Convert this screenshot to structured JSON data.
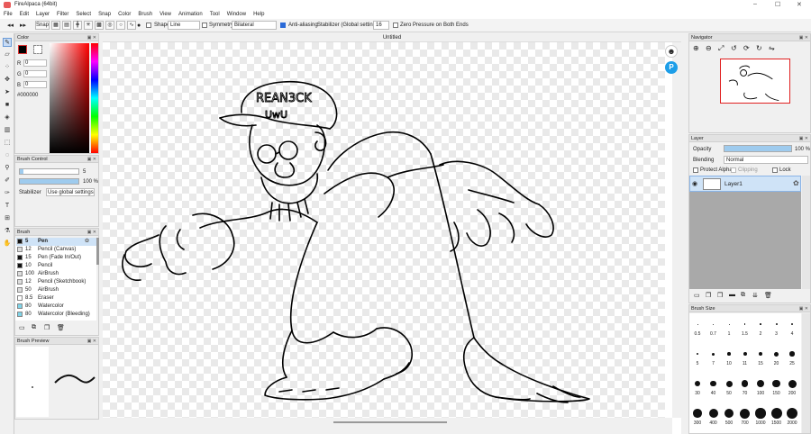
{
  "window": {
    "title": "FireAlpaca (64bit)",
    "min": "–",
    "max": "☐",
    "close": "✕"
  },
  "menu": [
    "File",
    "Edit",
    "Layer",
    "Filter",
    "Select",
    "Snap",
    "Color",
    "Brush",
    "View",
    "Animation",
    "Tool",
    "Window",
    "Help"
  ],
  "toolbar": {
    "snap": "Snap",
    "shape_label": "Shape",
    "shape_value": "Line",
    "symmetry_label": "Symmetry",
    "symmetry_value": "Bilateral",
    "antialias": "Anti-aliasing",
    "stabilizer_label": "Stabilizer (Global settings)",
    "stabilizer_value": "16",
    "zero_pressure": "Zero Pressure on Both Ends"
  },
  "color_panel": {
    "title": "Color",
    "r_label": "R",
    "r": "0",
    "g_label": "G",
    "g": "0",
    "b_label": "B",
    "b": "0",
    "hex": "#000000"
  },
  "brush_control": {
    "title": "Brush Control",
    "size": "5",
    "opacity": "100 %",
    "stabilizer_label": "Stabilizer",
    "stabilizer_value": "Use global settings"
  },
  "brush_panel": {
    "title": "Brush",
    "items": [
      {
        "size": "5",
        "name": "Pen",
        "color": "#111111"
      },
      {
        "size": "12",
        "name": "Pencil (Canvas)",
        "color": "#dddddd"
      },
      {
        "size": "15",
        "name": "Pen (Fade In/Out)",
        "color": "#111111"
      },
      {
        "size": "10",
        "name": "Pencil",
        "color": "#111111"
      },
      {
        "size": "100",
        "name": "AirBrush",
        "color": "#dddddd"
      },
      {
        "size": "12",
        "name": "Pencil (Sketchbook)",
        "color": "#dddddd"
      },
      {
        "size": "50",
        "name": "AirBrush",
        "color": "#dddddd"
      },
      {
        "size": "8.5",
        "name": "Eraser",
        "color": "#ffffff"
      },
      {
        "size": "80",
        "name": "Watercolor",
        "color": "#7fd4e8"
      },
      {
        "size": "80",
        "name": "Watercolor (Bleeding)",
        "color": "#7fd4e8"
      }
    ]
  },
  "brush_preview": {
    "title": "Brush Preview"
  },
  "document": {
    "title": "Untitled"
  },
  "navigator": {
    "title": "Navigator"
  },
  "layer_panel": {
    "title": "Layer",
    "opacity_label": "Opacity",
    "opacity_value": "100 %",
    "blending_label": "Blending",
    "blending_value": "Normal",
    "protect_alpha": "Protect Alpha",
    "clipping": "Clipping",
    "lock": "Lock",
    "layer_name": "Layer1"
  },
  "brush_size": {
    "title": "Brush Size",
    "sizes": [
      "0.5",
      "0.7",
      "1",
      "1.5",
      "2",
      "3",
      "4",
      "5",
      "7",
      "10",
      "11",
      "15",
      "20",
      "25",
      "30",
      "40",
      "50",
      "70",
      "100",
      "150",
      "200",
      "300",
      "400",
      "500",
      "700",
      "1000",
      "1500",
      "2000"
    ]
  }
}
